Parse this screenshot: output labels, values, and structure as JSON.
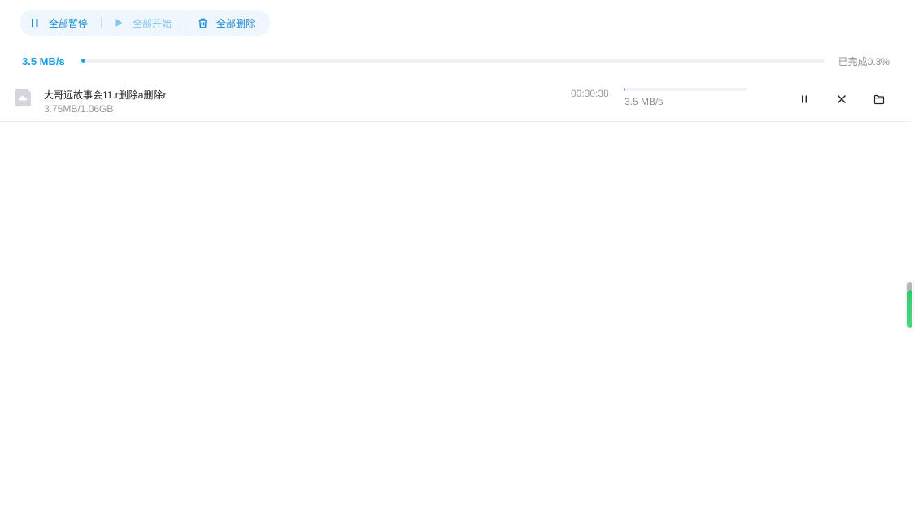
{
  "toolbar": {
    "pause_all_label": "全部暂停",
    "start_all_label": "全部开始",
    "delete_all_label": "全部删除"
  },
  "overall": {
    "speed": "3.5 MB/s",
    "progress_percent": 0.3,
    "done_label": "已完成0.3%"
  },
  "tasks": [
    {
      "name": "大哥远故事会11.r删除a删除r",
      "size": "3.75MB/1.06GB",
      "remaining_time": "00:30:38",
      "progress_percent": 0.3,
      "speed": "3.5 MB/s"
    }
  ],
  "colors": {
    "accent": "#1a9ee6",
    "toolbar_bg": "#eef7fd",
    "toolbar_text": "#1787d6",
    "scroll_green": "#2ecc71"
  },
  "icons": {
    "pause": "pause-icon",
    "play": "play-icon",
    "trash": "trash-icon",
    "file": "file-cloud-icon",
    "close": "close-icon",
    "folder": "folder-icon"
  }
}
